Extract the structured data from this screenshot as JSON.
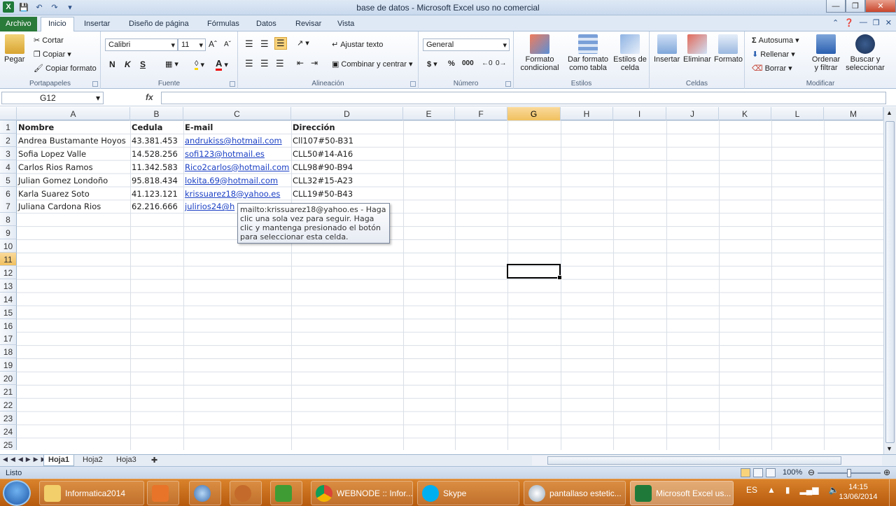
{
  "window": {
    "title": "base de datos  -  Microsoft Excel uso no comercial"
  },
  "tabs": [
    "Archivo",
    "Inicio",
    "Insertar",
    "Diseño de página",
    "Fórmulas",
    "Datos",
    "Revisar",
    "Vista"
  ],
  "ribbon": {
    "clipboard": {
      "paste": "Pegar",
      "cut": "Cortar",
      "copy": "Copiar",
      "format_painter": "Copiar formato",
      "label": "Portapapeles"
    },
    "font": {
      "name": "Calibri",
      "size": "11",
      "bold": "N",
      "italic": "K",
      "underline": "S",
      "label": "Fuente"
    },
    "alignment": {
      "wrap": "Ajustar texto",
      "merge": "Combinar y centrar",
      "label": "Alineación"
    },
    "number": {
      "format": "General",
      "currency": "$",
      "percent": "%",
      "thousands": "000",
      "label": "Número"
    },
    "styles": {
      "conditional": "Formato condicional",
      "table": "Dar formato como tabla",
      "cell_styles": "Estilos de celda",
      "label": "Estilos"
    },
    "cells": {
      "insert": "Insertar",
      "delete": "Eliminar",
      "format": "Formato",
      "label": "Celdas"
    },
    "editing": {
      "autosum": "Autosuma",
      "fill": "Rellenar",
      "clear": "Borrar",
      "sort": "Ordenar y filtrar",
      "find": "Buscar y seleccionar",
      "label": "Modificar"
    }
  },
  "formula_bar": {
    "name_box": "G12",
    "fx": "fx",
    "formula": ""
  },
  "columns": [
    "A",
    "B",
    "C",
    "D",
    "E",
    "F",
    "G",
    "H",
    "I",
    "J",
    "K",
    "L",
    "M"
  ],
  "rows": [
    "1",
    "2",
    "3",
    "4",
    "5",
    "6",
    "7",
    "8",
    "9",
    "10",
    "11",
    "12",
    "13",
    "14",
    "15",
    "16",
    "17",
    "18",
    "19",
    "20",
    "21",
    "22",
    "23",
    "24",
    "25"
  ],
  "sheet": {
    "headers": {
      "name": "Nombre",
      "id": "Cedula",
      "email": "E-mail",
      "address": "Dirección"
    },
    "records": [
      {
        "name": "Andrea Bustamante Hoyos",
        "id": "43.381.453",
        "email": "andrukiss@hotmail.com",
        "address": "Cll107#50-B31"
      },
      {
        "name": "Sofia Lopez Valle",
        "id": "14.528.256",
        "email": "sofi123@hotmail.es",
        "address": "CLL50#14-A16"
      },
      {
        "name": "Carlos Rios Ramos",
        "id": "11.342.583",
        "email": "Rico2carlos@hotmail.com",
        "address": "CLL98#90-B94"
      },
      {
        "name": "Julian Gomez Londoño",
        "id": "95.818.434",
        "email": "lokita.69@hotmail.com",
        "address": "CLL32#15-A23"
      },
      {
        "name": "Karla Suarez Soto",
        "id": "41.123.121",
        "email": "krissuarez18@yahoo.es",
        "address": "CLL19#50-B43"
      },
      {
        "name": "Juliana Cardona Rios",
        "id": "62.216.666",
        "email": "julirios24@h",
        "address": ""
      }
    ]
  },
  "tooltip": "mailto:krissuarez18@yahoo.es - Haga clic una sola vez para seguir. Haga clic y mantenga presionado el botón para seleccionar esta celda.",
  "sheet_tabs": [
    "Hoja1",
    "Hoja2",
    "Hoja3"
  ],
  "status": {
    "text": "Listo",
    "zoom": "100%"
  },
  "taskbar": {
    "items": [
      "Informatica2014",
      "WEBNODE :: Infor...",
      "Skype",
      "pantallaso estetic...",
      "Microsoft Excel us..."
    ],
    "lang": "ES",
    "time": "14:15",
    "date": "13/06/2014"
  }
}
